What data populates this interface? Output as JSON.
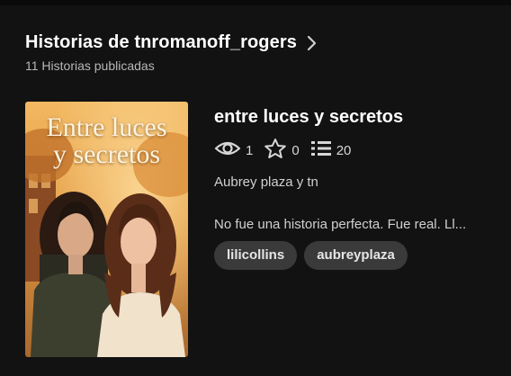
{
  "header": {
    "title": "Historias de tnromanoff_rogers",
    "subtitle": "11 Historias publicadas"
  },
  "story": {
    "cover_title_line1": "Entre luces",
    "cover_title_line2": "y secretos",
    "title": "entre luces y secretos",
    "stats": {
      "views": "1",
      "votes": "0",
      "parts": "20"
    },
    "author_line": "Aubrey plaza y tn",
    "description": "No fue una historia perfecta. Fue real. Ll...",
    "tags": [
      "lilicollins",
      "aubreyplaza"
    ]
  },
  "colors": {
    "background": "#121212",
    "tag_background": "#3a3a3a",
    "cover_sky": "#e8a04a"
  }
}
